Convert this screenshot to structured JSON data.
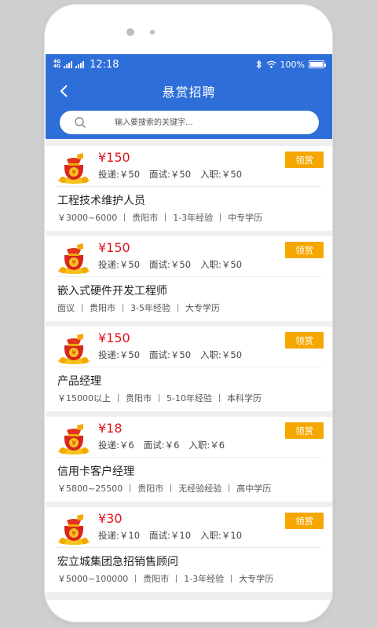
{
  "status": {
    "network": [
      "4G",
      "4G"
    ],
    "time": "12:18",
    "battery": "100%",
    "battery_level": 1.0
  },
  "header": {
    "title": "悬赏招聘"
  },
  "search": {
    "placeholder": "输入要搜索的关键字..."
  },
  "jobs": [
    {
      "reward": "¥150",
      "fees": [
        "投递:￥50",
        "面试:￥50",
        "入职:￥50"
      ],
      "claim_label": "领赏",
      "title": "工程技术维护人员",
      "salary": "￥3000~6000",
      "location": "贵阳市",
      "experience": "1-3年经验",
      "education": "中专学历"
    },
    {
      "reward": "¥150",
      "fees": [
        "投递:￥50",
        "面试:￥50",
        "入职:￥50"
      ],
      "claim_label": "领赏",
      "title": "嵌入式硬件开发工程师",
      "salary": "面议",
      "location": "贵阳市",
      "experience": "3-5年经验",
      "education": "大专学历"
    },
    {
      "reward": "¥150",
      "fees": [
        "投递:￥50",
        "面试:￥50",
        "入职:￥50"
      ],
      "claim_label": "领赏",
      "title": "产品经理",
      "salary": "￥15000以上",
      "location": "贵阳市",
      "experience": "5-10年经验",
      "education": "本科学历"
    },
    {
      "reward": "¥18",
      "fees": [
        "投递:￥6",
        "面试:￥6",
        "入职:￥6"
      ],
      "claim_label": "领赏",
      "title": "信用卡客户经理",
      "salary": "￥5800~25500",
      "location": "贵阳市",
      "experience": "无经验经验",
      "education": "高中学历"
    },
    {
      "reward": "¥30",
      "fees": [
        "投递:￥10",
        "面试:￥10",
        "入职:￥10"
      ],
      "claim_label": "领赏",
      "title": "宏立城集团急招销售顾问",
      "salary": "￥5000~100000",
      "location": "贵阳市",
      "experience": "1-3年经验",
      "education": "大专学历"
    }
  ],
  "colors": {
    "header_blue": "#2e6ed8",
    "reward_red": "#e0141b",
    "claim_orange": "#f5a700"
  },
  "icons": {
    "back": "back-arrow-icon",
    "search": "search-icon",
    "bag": "money-bag-icon"
  }
}
